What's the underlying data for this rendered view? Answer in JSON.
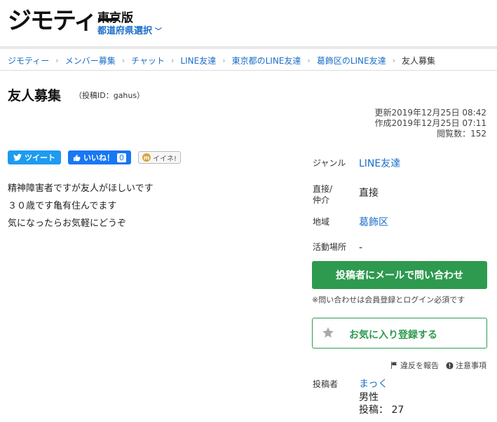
{
  "header": {
    "logo_text": "ジモティー",
    "edition": "東京版",
    "pref_select_label": "都道府県選択"
  },
  "breadcrumb": [
    "ジモティー",
    "メンバー募集",
    "チャット",
    "LINE友達",
    "東京都のLINE友達",
    "葛飾区のLINE友達",
    "友人募集"
  ],
  "post": {
    "title": "友人募集",
    "post_id": "（投稿ID：gahus）",
    "updated": "更新2019年12月25日 08:42",
    "created": "作成2019年12月25日 07:11",
    "views": "閲覧数：152",
    "body_lines": [
      "精神障害者ですが友人がほしいです",
      "３０歳です亀有住んでます",
      "気になったらお気軽にどうぞ"
    ]
  },
  "social": {
    "tweet_label": "ツイート",
    "like_label": "いいね！",
    "like_count": "0",
    "iine_label": "イイネ!"
  },
  "info": {
    "genre_label": "ジャンル",
    "genre_value": "LINE友達",
    "direct_label_1": "直接/",
    "direct_label_2": "仲介",
    "direct_value": "直接",
    "area_label": "地域",
    "area_value": "葛飾区",
    "place_label": "活動場所",
    "place_value": "-"
  },
  "actions": {
    "mail_button": "投稿者にメールで問い合わせ",
    "mail_note": "※問い合わせは会員登録とログイン必須です",
    "fav_button": "お気に入り登録する",
    "report_label": "違反を報告",
    "notes_label": "注意事項"
  },
  "poster": {
    "label": "投稿者",
    "name": "まっく",
    "gender": "男性",
    "count": "投稿：  27"
  },
  "colors": {
    "link": "#1a6ec8",
    "green": "#2e9a4f",
    "tweet": "#1d9bf0",
    "facebook": "#1877f2"
  }
}
